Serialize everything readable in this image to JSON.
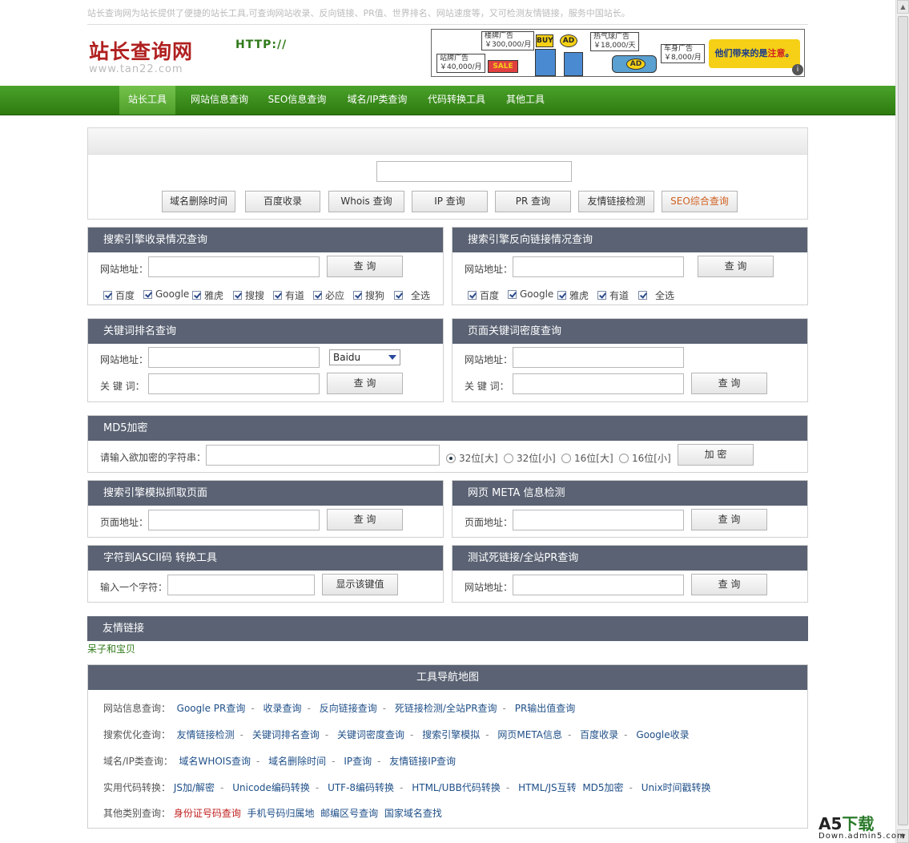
{
  "top_text": "站长查询网为站长提供了便捷的站长工具,可查询网站收录、反向链接、PR值、世界排名、网站速度等，又可检测友情链接，服务中国站长。",
  "logo": {
    "name": "站长查询网",
    "url": "www.tan22.com"
  },
  "banner": {
    "tags": [
      "楼牌广告\n￥300,000/月",
      "热气球广告\n￥18,000/天",
      "站牌广告\n￥40,000/月",
      "车身广告\n￥8,000/月"
    ],
    "slogan_prefix": "他们带来的是",
    "slogan_highlight": "注意",
    "slogan_suffix": "。",
    "info_icon": "i"
  },
  "nav": [
    "站长工具",
    "网站信息查询",
    "SEO信息查询",
    "域名/IP类查询",
    "代码转换工具",
    "其他工具"
  ],
  "search": {
    "http_label": "HTTP://",
    "buttons": [
      "域名删除时间",
      "百度收录",
      "Whois 查询",
      "IP 查询",
      "PR 查询",
      "友情链接检测",
      "SEO综合查询"
    ]
  },
  "panels": {
    "index": {
      "title": "搜索引擎收录情况查询",
      "site_label": "网站地址：",
      "button": "查 询",
      "engines": [
        "百度",
        "Google",
        "雅虎",
        "搜搜",
        "有道",
        "必应",
        "搜狗",
        "全选"
      ]
    },
    "backlink": {
      "title": "搜索引擎反向链接情况查询",
      "site_label": "网站地址：",
      "button": "查 询",
      "engines": [
        "百度",
        "Google",
        "雅虎",
        "有道",
        "全选"
      ]
    },
    "keyword_rank": {
      "title": "关键词排名查询",
      "site_label": "网站地址：",
      "keyword_label": "关 键 词：",
      "select_value": "Baidu",
      "button": "查 询"
    },
    "keyword_density": {
      "title": "页面关键词密度查询",
      "site_label": "网站地址：",
      "keyword_label": "关 键 词：",
      "button": "查 询"
    },
    "md5": {
      "title": "MD5加密",
      "label": "请输入欲加密的字符串：",
      "options": [
        "32位[大]",
        "32位[小]",
        "16位[大]",
        "16位[小]"
      ],
      "button": "加 密"
    },
    "spider": {
      "title": "搜索引擎模拟抓取页面",
      "label": "页面地址：",
      "button": "查 询"
    },
    "meta": {
      "title": "网页  META 信息检测",
      "label": "页面地址：",
      "button": "查 询"
    },
    "ascii": {
      "title": "字符到ASCII码 转换工具",
      "label": "输入一个字符：",
      "button": "显示该键值"
    },
    "deadlink": {
      "title": "测试死链接/全站PR查询",
      "label": "网站地址：",
      "button": "查 询"
    },
    "friends": {
      "title": "友情链接",
      "link": "呆子和宝贝"
    },
    "sitemap": {
      "title": "工具导航地图",
      "rows": [
        {
          "label": "网站信息查询：",
          "links": [
            "Google PR查询",
            "收录查询",
            "反向链接查询",
            "死链接检测/全站PR查询",
            "PR输出值查询"
          ]
        },
        {
          "label": "搜索优化查询：",
          "links": [
            "友情链接检测",
            "关键词排名查询",
            "关键词密度查询",
            "搜索引擎模拟",
            "网页META信息",
            "百度收录",
            "Google收录"
          ]
        },
        {
          "label": "域名/IP类查询：",
          "links": [
            "域名WHOIS查询",
            "域名删除时间",
            "IP查询",
            "友情链接IP查询"
          ]
        },
        {
          "label": "实用代码转换：",
          "links": [
            "JS加/解密",
            "Unicode编码转换",
            "UTF-8编码转换",
            "HTML/UBB代码转换",
            "HTML/JS互转",
            "MD5加密",
            "Unix时间戳转换"
          ]
        },
        {
          "label": "其他类别查询：",
          "links": [
            "身份证号码查询",
            "手机号码归属地",
            "邮编区号查询",
            "国家域名查找"
          ]
        }
      ]
    }
  },
  "watermark": {
    "a5": "A5",
    "xiazai": "下载",
    "url": "Down.admin5.com"
  }
}
